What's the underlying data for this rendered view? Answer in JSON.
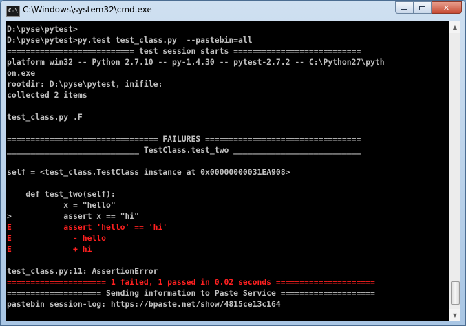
{
  "window": {
    "title": "C:\\Windows\\system32\\cmd.exe",
    "app_icon_text": "C:\\"
  },
  "controls": {
    "minimize": "minimize",
    "maximize": "maximize",
    "close": "✕"
  },
  "console": {
    "lines": [
      {
        "text": "D:\\pyse\\pytest>",
        "color": "normal"
      },
      {
        "text": "D:\\pyse\\pytest>py.test test_class.py  --pastebin=all",
        "color": "normal"
      },
      {
        "text": "=========================== test session starts ===========================",
        "color": "normal"
      },
      {
        "text": "platform win32 -- Python 2.7.10 -- py-1.4.30 -- pytest-2.7.2 -- C:\\Python27\\pyth",
        "color": "normal"
      },
      {
        "text": "on.exe",
        "color": "normal"
      },
      {
        "text": "rootdir: D:\\pyse\\pytest, inifile:",
        "color": "normal"
      },
      {
        "text": "collected 2 items",
        "color": "normal"
      },
      {
        "text": "",
        "color": "normal"
      },
      {
        "text": "test_class.py .F",
        "color": "normal"
      },
      {
        "text": "",
        "color": "normal"
      },
      {
        "text": "================================ FAILURES =================================",
        "color": "normal"
      },
      {
        "text": "____________________________ TestClass.test_two ___________________________",
        "color": "normal"
      },
      {
        "text": "",
        "color": "normal"
      },
      {
        "text": "self = <test_class.TestClass instance at 0x00000000031EA908>",
        "color": "normal"
      },
      {
        "text": "",
        "color": "normal"
      },
      {
        "text": "    def test_two(self):",
        "color": "normal"
      },
      {
        "text": "            x = \"hello\"",
        "color": "normal"
      },
      {
        "text": ">           assert x == \"hi\"",
        "color": "normal"
      },
      {
        "text": "E           assert 'hello' == 'hi'",
        "color": "red"
      },
      {
        "text": "E             - hello",
        "color": "red"
      },
      {
        "text": "E             + hi",
        "color": "red"
      },
      {
        "text": "",
        "color": "normal"
      },
      {
        "text": "test_class.py:11: AssertionError",
        "color": "normal"
      },
      {
        "text": "===================== 1 failed, 1 passed in 0.02 seconds =====================",
        "color": "red"
      },
      {
        "text": "==================== Sending information to Paste Service ====================",
        "color": "normal"
      },
      {
        "text": "pastebin session-log: https://bpaste.net/show/4815ce13c164",
        "color": "normal"
      }
    ]
  },
  "scrollbar": {
    "up_icon": "▲",
    "down_icon": "▼"
  },
  "colors": {
    "normal_text": "#c0c0c0",
    "error_text": "#ff2020",
    "background": "#000000"
  }
}
